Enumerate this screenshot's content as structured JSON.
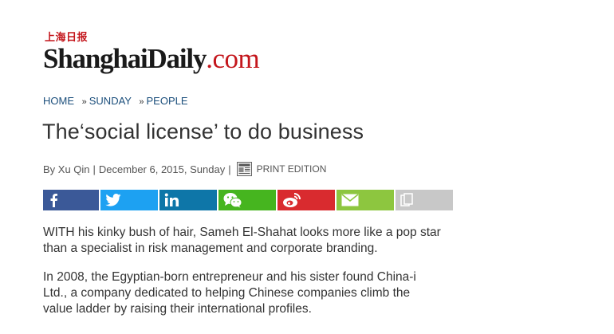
{
  "logo": {
    "cn": "上海日报",
    "brand": "ShanghaiDaily",
    "dot": ".",
    "tld": "com"
  },
  "breadcrumb": [
    {
      "label": "HOME"
    },
    {
      "sep": "»",
      "label": "SUNDAY"
    },
    {
      "sep": "»",
      "label": "PEOPLE"
    }
  ],
  "article": {
    "title": "The‘social license’ to do business",
    "byline": {
      "author": "By Xu Qin",
      "sep1": "|",
      "date": "December 6, 2015, Sunday",
      "sep2": "|",
      "print_label": "PRINT EDITION"
    },
    "paragraphs": [
      "WITH his kinky bush of hair, Sameh El-Shahat looks more like a pop star than a specialist in risk management and corporate branding.",
      "In 2008, the Egyptian-born entrepreneur and his sister found China-i Ltd., a company dedicated to helping Chinese companies climb the value ladder by raising their international profiles."
    ]
  },
  "share": {
    "icons": [
      "facebook-icon",
      "twitter-icon",
      "linkedin-icon",
      "wechat-icon",
      "weibo-icon",
      "email-icon",
      "copy-icon"
    ],
    "colors": {
      "facebook": "#3b5998",
      "twitter": "#1da1f2",
      "linkedin": "#0e76a8",
      "wechat": "#46b51f",
      "weibo": "#d92b2f",
      "email": "#8dc63f",
      "copy": "#c8c8c8"
    }
  },
  "colors": {
    "brand_red": "#c4161c",
    "link_blue": "#1c4f7c",
    "text": "#333333"
  }
}
